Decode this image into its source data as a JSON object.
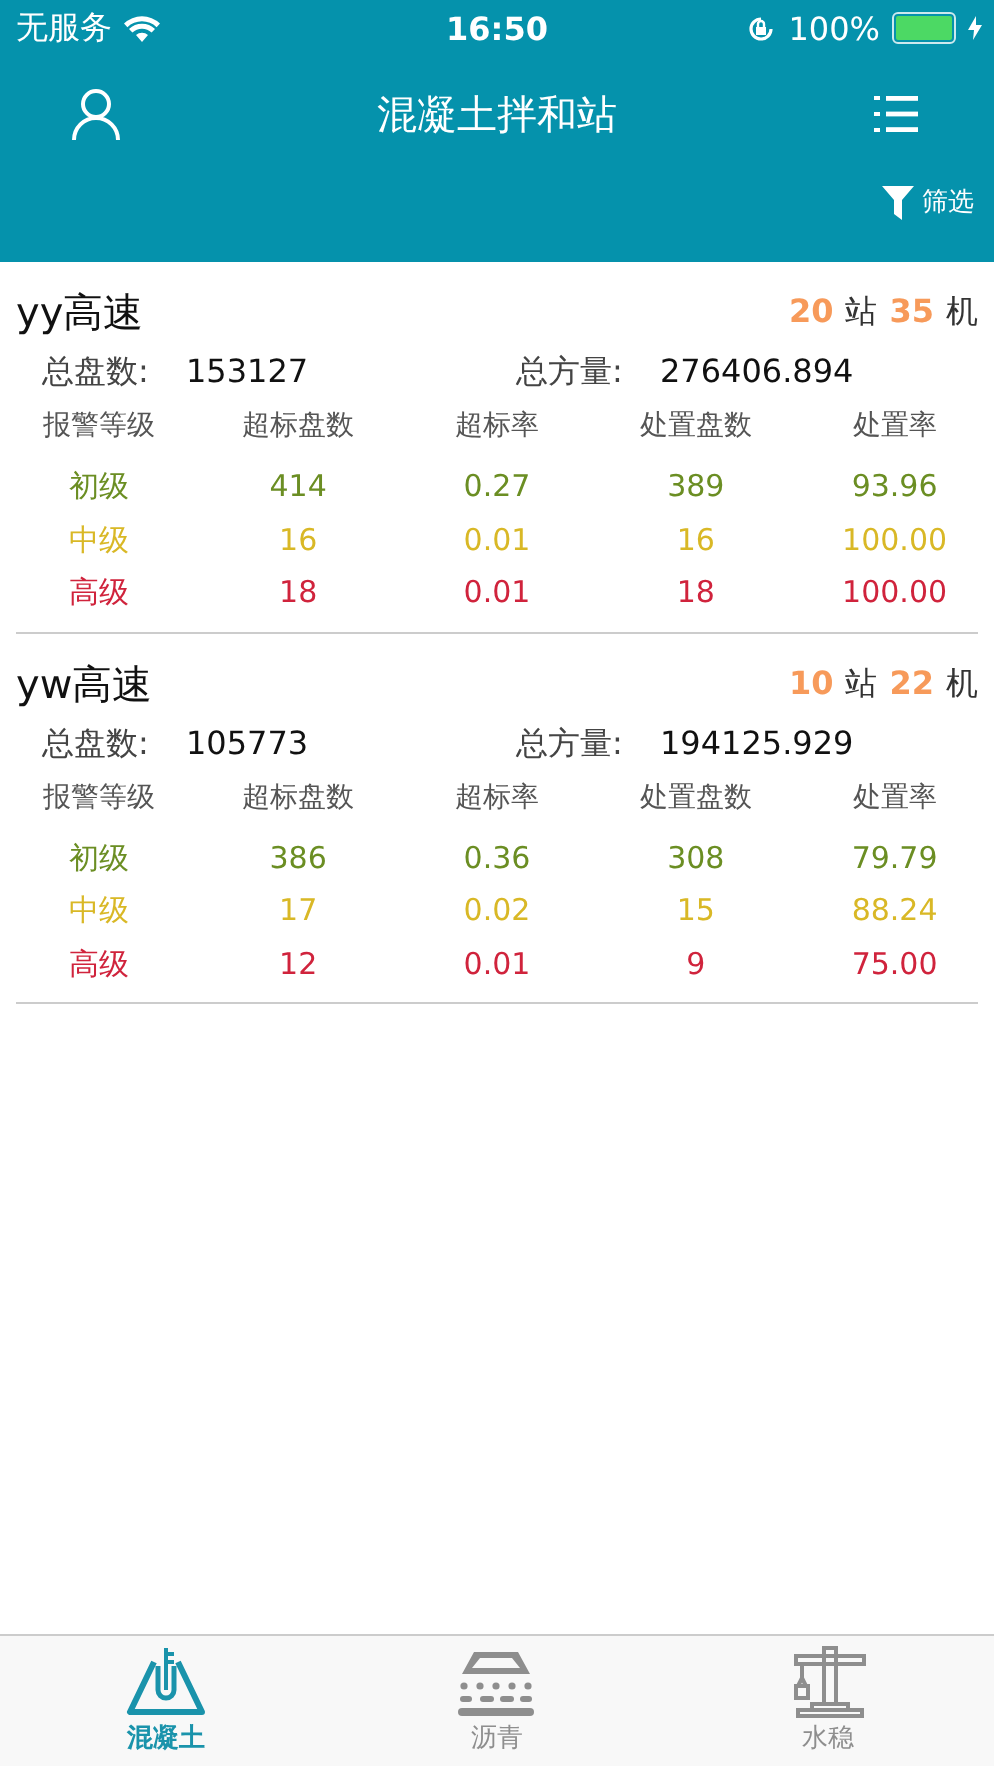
{
  "status_bar": {
    "carrier": "无服务",
    "time": "16:50",
    "battery": "100%"
  },
  "nav": {
    "title": "混凝土拌和站",
    "filter": "筛选"
  },
  "sections": [
    {
      "name": "yy高速",
      "stations": "20",
      "station_unit": "站",
      "machines": "35",
      "machine_unit": "机",
      "total_label": "总盘数:",
      "total": "153127",
      "volume_label": "总方量:",
      "volume": "276406.894",
      "columns": [
        "报警等级",
        "超标盘数",
        "超标率",
        "处置盘数",
        "处置率"
      ],
      "rows": [
        {
          "color": "#6b8e23",
          "cells": [
            "初级",
            "414",
            "0.27",
            "389",
            "93.96"
          ]
        },
        {
          "color": "#d9b826",
          "cells": [
            "中级",
            "16",
            "0.01",
            "16",
            "100.00"
          ]
        },
        {
          "color": "#d0233c",
          "cells": [
            "高级",
            "18",
            "0.01",
            "18",
            "100.00"
          ]
        }
      ]
    },
    {
      "name": "yw高速",
      "stations": "10",
      "station_unit": "站",
      "machines": "22",
      "machine_unit": "机",
      "total_label": "总盘数:",
      "total": "105773",
      "volume_label": "总方量:",
      "volume": "194125.929",
      "columns": [
        "报警等级",
        "超标盘数",
        "超标率",
        "处置盘数",
        "处置率"
      ],
      "rows": [
        {
          "color": "#6b8e23",
          "cells": [
            "初级",
            "386",
            "0.36",
            "308",
            "79.79"
          ]
        },
        {
          "color": "#d9b826",
          "cells": [
            "中级",
            "17",
            "0.02",
            "15",
            "88.24"
          ]
        },
        {
          "color": "#d0233c",
          "cells": [
            "高级",
            "12",
            "0.01",
            "9",
            "75.00"
          ]
        }
      ]
    }
  ],
  "tabs": [
    {
      "kind": "concrete",
      "label": "混凝土",
      "selected": true
    },
    {
      "kind": "asphalt",
      "label": "沥青",
      "selected": false
    },
    {
      "kind": "crane",
      "label": "水稳",
      "selected": false
    }
  ]
}
